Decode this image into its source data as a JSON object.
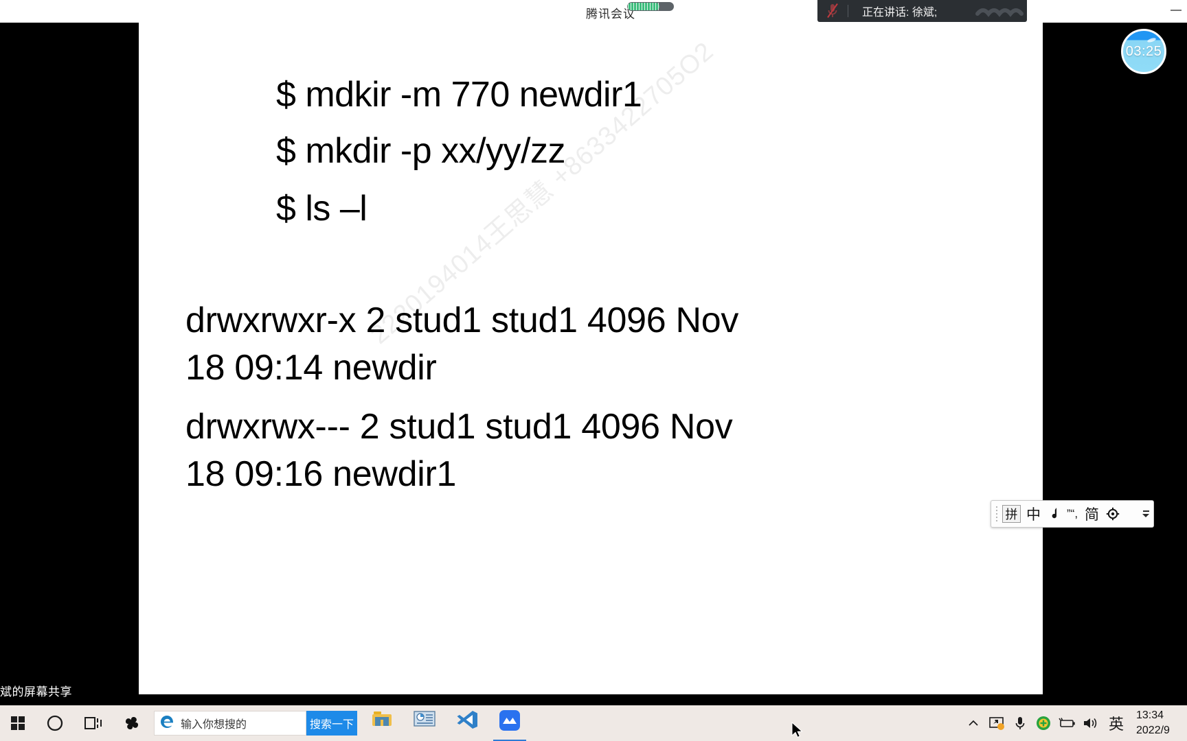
{
  "meeting": {
    "app_title": "腾讯会议",
    "signal_level_percent": 68,
    "speaking_banner": {
      "mic_icon": "mic-muted-icon",
      "label": "正在讲话: 徐斌;"
    },
    "timer_badge": {
      "label": "03:25",
      "color": "#8ad6f5"
    },
    "share_label": "斌的屏幕共享"
  },
  "slide": {
    "commands": [
      "$ mdkir -m 770 newdir1",
      "$ mkdir -p xx/yy/zz",
      "$ ls –l"
    ],
    "listing": [
      {
        "line1": "drwxrwxr-x    2 stud1    stud1      4096 Nov",
        "line2": "18 09:14 newdir"
      },
      {
        "line1": "drwxrwx---    2 stud1    stud1      4096 Nov",
        "line2": "18 09:16 newdir1"
      }
    ],
    "watermark": "2220194014王思慧 +8633422705O2"
  },
  "ime_toolbar": {
    "mode_label": "拼",
    "language_label": "中",
    "tone_icon": "music-note-icon",
    "punctuation_label": "”“,",
    "charset_label": "简",
    "settings_icon": "gear-icon",
    "expand_icon": "chevron-down-icon"
  },
  "taskbar": {
    "start_icon": "windows-start-icon",
    "cortana_icon": "cortana-circle-icon",
    "taskview_icon": "task-view-icon",
    "pinwheel_icon": "sogou-pinwheel-icon",
    "search": {
      "browser_icon": "edge-icon",
      "placeholder": "输入你想搜的",
      "button_label": "搜索一下"
    },
    "apps": [
      {
        "name": "file-explorer",
        "label": "文件资源管理器"
      },
      {
        "name": "powerpoint",
        "label": "PowerPoint"
      },
      {
        "name": "vscode",
        "label": "Visual Studio Code"
      },
      {
        "name": "tencent-meeting",
        "label": "腾讯会议",
        "active": true
      }
    ],
    "tray": {
      "overflow_icon": "chevron-up-icon",
      "screenshare_icon": "screen-share-icon",
      "microphone_icon": "microphone-icon",
      "antivirus_icon": "security-shield-icon",
      "battery_icon": "battery-charging-icon",
      "volume_icon": "speaker-icon",
      "ime_indicator": "英",
      "clock_time": "13:34",
      "clock_date": "2022/9"
    }
  }
}
